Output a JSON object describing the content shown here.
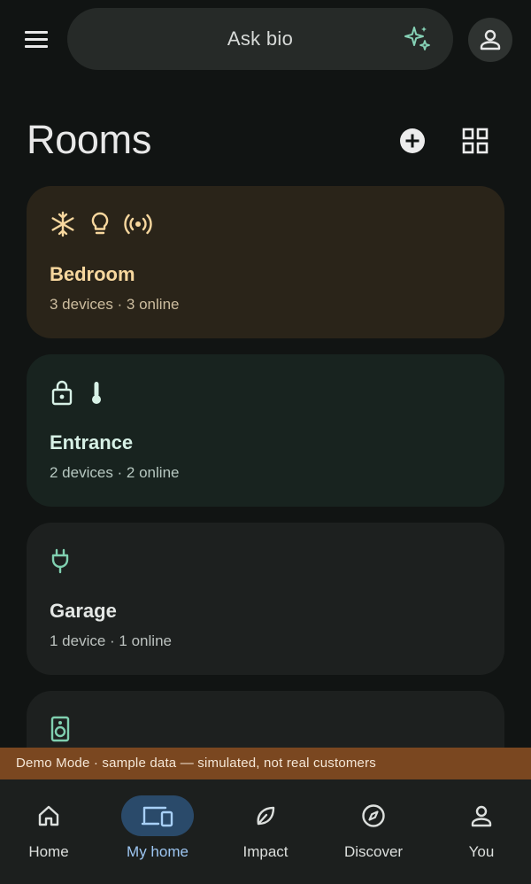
{
  "search": {
    "label": "Ask bio",
    "icon": "sparkle-icon"
  },
  "header": {
    "title": "Rooms"
  },
  "rooms": [
    {
      "name": "Bedroom",
      "summary": "3 devices · 3 online",
      "icons": [
        "snowflake-icon",
        "lightbulb-icon",
        "sensor-icon"
      ],
      "accent": "#f7d79e"
    },
    {
      "name": "Entrance",
      "summary": "2 devices · 2 online",
      "icons": [
        "lock-icon",
        "thermometer-icon"
      ],
      "accent": "#d7f1e6"
    },
    {
      "name": "Garage",
      "summary": "1 device · 1 online",
      "icons": [
        "plug-icon"
      ],
      "accent": "#80d0b0"
    },
    {
      "name": "",
      "summary": "",
      "icons": [
        "speaker-icon"
      ],
      "accent": "#80d0b0"
    }
  ],
  "banner": {
    "text": "Demo Mode · sample data — simulated, not real customers",
    "color": "#7a4720"
  },
  "nav": {
    "items": [
      {
        "label": "Home",
        "icon": "home-icon"
      },
      {
        "label": "My home",
        "icon": "devices-icon",
        "active": true
      },
      {
        "label": "Impact",
        "icon": "leaf-icon"
      },
      {
        "label": "Discover",
        "icon": "compass-icon"
      },
      {
        "label": "You",
        "icon": "person-icon"
      }
    ],
    "active_color": "#9dc6f2"
  }
}
